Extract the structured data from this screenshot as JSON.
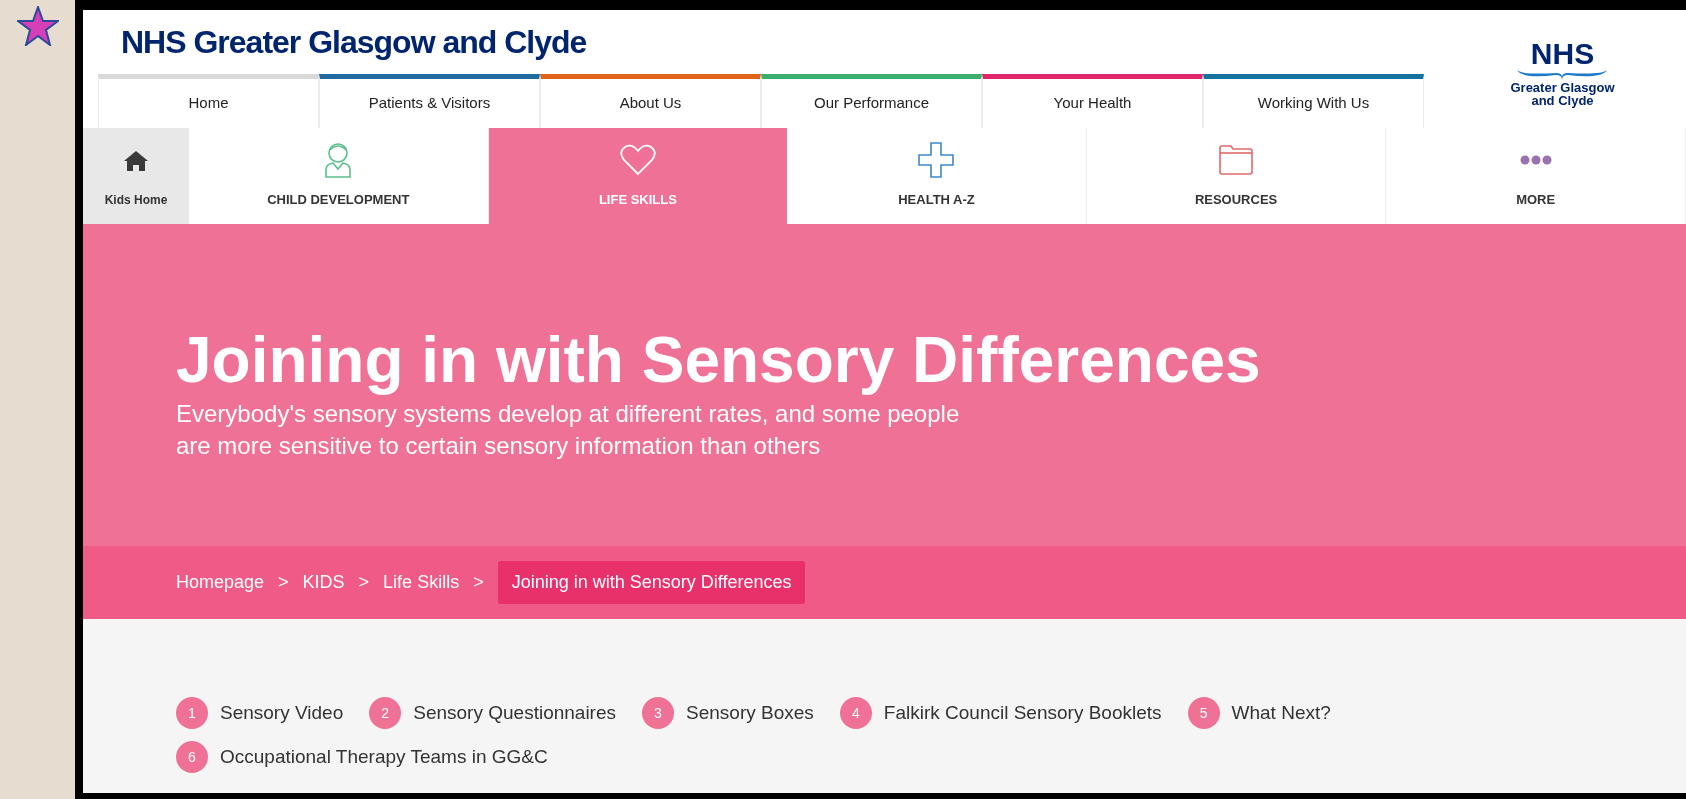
{
  "site_title": "NHS Greater Glasgow and Clyde",
  "logo": {
    "mark": "NHS",
    "line_1": "Greater Glasgow",
    "line_2": "and Clyde"
  },
  "top_nav": [
    {
      "label": "Home",
      "color": "#d9d9d9"
    },
    {
      "label": "Patients & Visitors",
      "color": "#1f6aa0"
    },
    {
      "label": "About Us",
      "color": "#e0631b"
    },
    {
      "label": "Our Performance",
      "color": "#3aae6c"
    },
    {
      "label": "Your Health",
      "color": "#e0256a"
    },
    {
      "label": "Working With Us",
      "color": "#15719e"
    }
  ],
  "kids_nav": [
    {
      "label": "Kids Home",
      "kind": "home",
      "selected": false
    },
    {
      "label": "CHILD DEVELOPMENT",
      "kind": "child",
      "selected": false
    },
    {
      "label": "LIFE SKILLS",
      "kind": "heart",
      "selected": true
    },
    {
      "label": "HEALTH A-Z",
      "kind": "cross",
      "selected": false
    },
    {
      "label": "RESOURCES",
      "kind": "folder",
      "selected": false
    },
    {
      "label": "MORE",
      "kind": "dots",
      "selected": false
    }
  ],
  "hero": {
    "title": "Joining in with Sensory Differences",
    "subtitle_lines": [
      "Everybody's sensory systems develop at different rates, and some people",
      "are more sensitive to certain sensory information than others"
    ]
  },
  "breadcrumb": [
    {
      "label": "Homepage",
      "selected": false
    },
    {
      "label": "KIDS",
      "selected": false
    },
    {
      "label": "Life Skills",
      "selected": false
    },
    {
      "label": "Joining in with Sensory Differences",
      "selected": true
    }
  ],
  "breadcrumb_separator": ">",
  "sections": [
    {
      "number": "1",
      "label": "Sensory Video"
    },
    {
      "number": "2",
      "label": "Sensory Questionnaires"
    },
    {
      "number": "3",
      "label": "Sensory Boxes"
    },
    {
      "number": "4",
      "label": "Falkirk Council Sensory Booklets"
    },
    {
      "number": "5",
      "label": "What Next?"
    },
    {
      "number": "6",
      "label": "Occupational Therapy Teams in GG&C"
    }
  ]
}
